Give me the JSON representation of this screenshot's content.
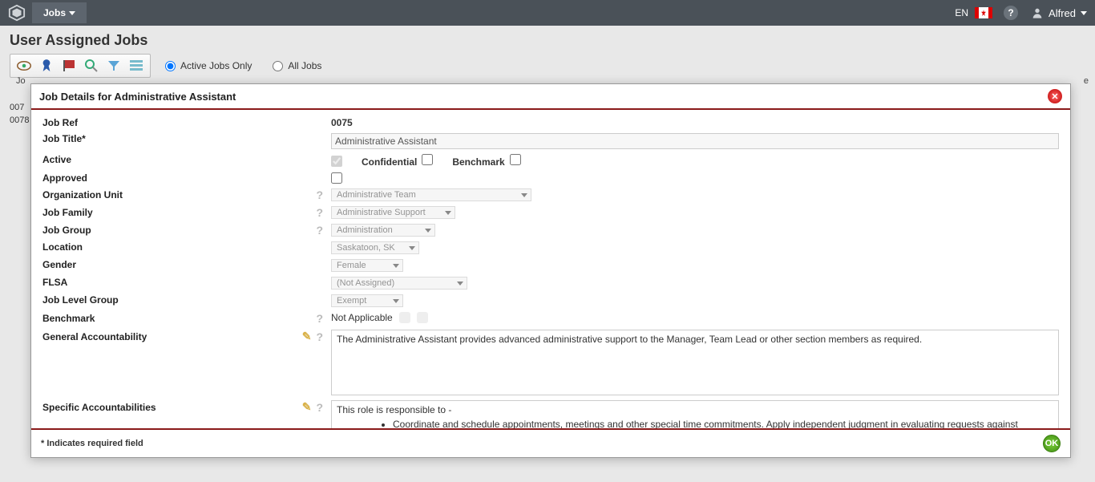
{
  "topbar": {
    "menu_label": "Jobs",
    "lang": "EN",
    "help_tooltip": "Help",
    "user_name": "Alfred"
  },
  "page": {
    "title": "User Assigned Jobs",
    "radio_active": "Active Jobs Only",
    "radio_all": "All Jobs",
    "col_hint_left": "Jo",
    "col_hint_right": "e",
    "row1": "007",
    "row2": "0078"
  },
  "toolbar_icons": {
    "eye": "view",
    "ribbon": "award",
    "flag": "flag",
    "search": "search",
    "funnel": "filter",
    "rows": "rows"
  },
  "modal": {
    "title": "Job Details for Administrative Assistant",
    "footer_note": "* Indicates required field",
    "labels": {
      "job_ref": "Job Ref",
      "job_title": "Job Title*",
      "active": "Active",
      "confidential": "Confidential",
      "benchmark_cb": "Benchmark",
      "approved": "Approved",
      "org_unit": "Organization Unit",
      "job_family": "Job Family",
      "job_group": "Job Group",
      "location": "Location",
      "gender": "Gender",
      "flsa": "FLSA",
      "job_level_group": "Job Level Group",
      "benchmark": "Benchmark",
      "general_accountability": "General Accountability",
      "specific_accountabilities": "Specific Accountabilities"
    },
    "values": {
      "job_ref": "0075",
      "job_title": "Administrative Assistant",
      "active": true,
      "confidential": false,
      "benchmark_cb": false,
      "approved": false,
      "org_unit": "Administrative Team",
      "job_family": "Administrative Support",
      "job_group": "Administration",
      "location": "Saskatoon, SK",
      "gender": "Female",
      "flsa": "(Not Assigned)",
      "job_level_group": "Exempt",
      "benchmark": "Not Applicable",
      "general_accountability": "The Administrative Assistant provides advanced administrative support to the Manager, Team Lead or other section members as required.",
      "specific_intro": "This role is responsible to -",
      "specific_bullet1": "Coordinate and schedule appointments, meetings and other special time commitments.  Apply independent judgment in evaluating requests against established guidelines provided"
    }
  }
}
